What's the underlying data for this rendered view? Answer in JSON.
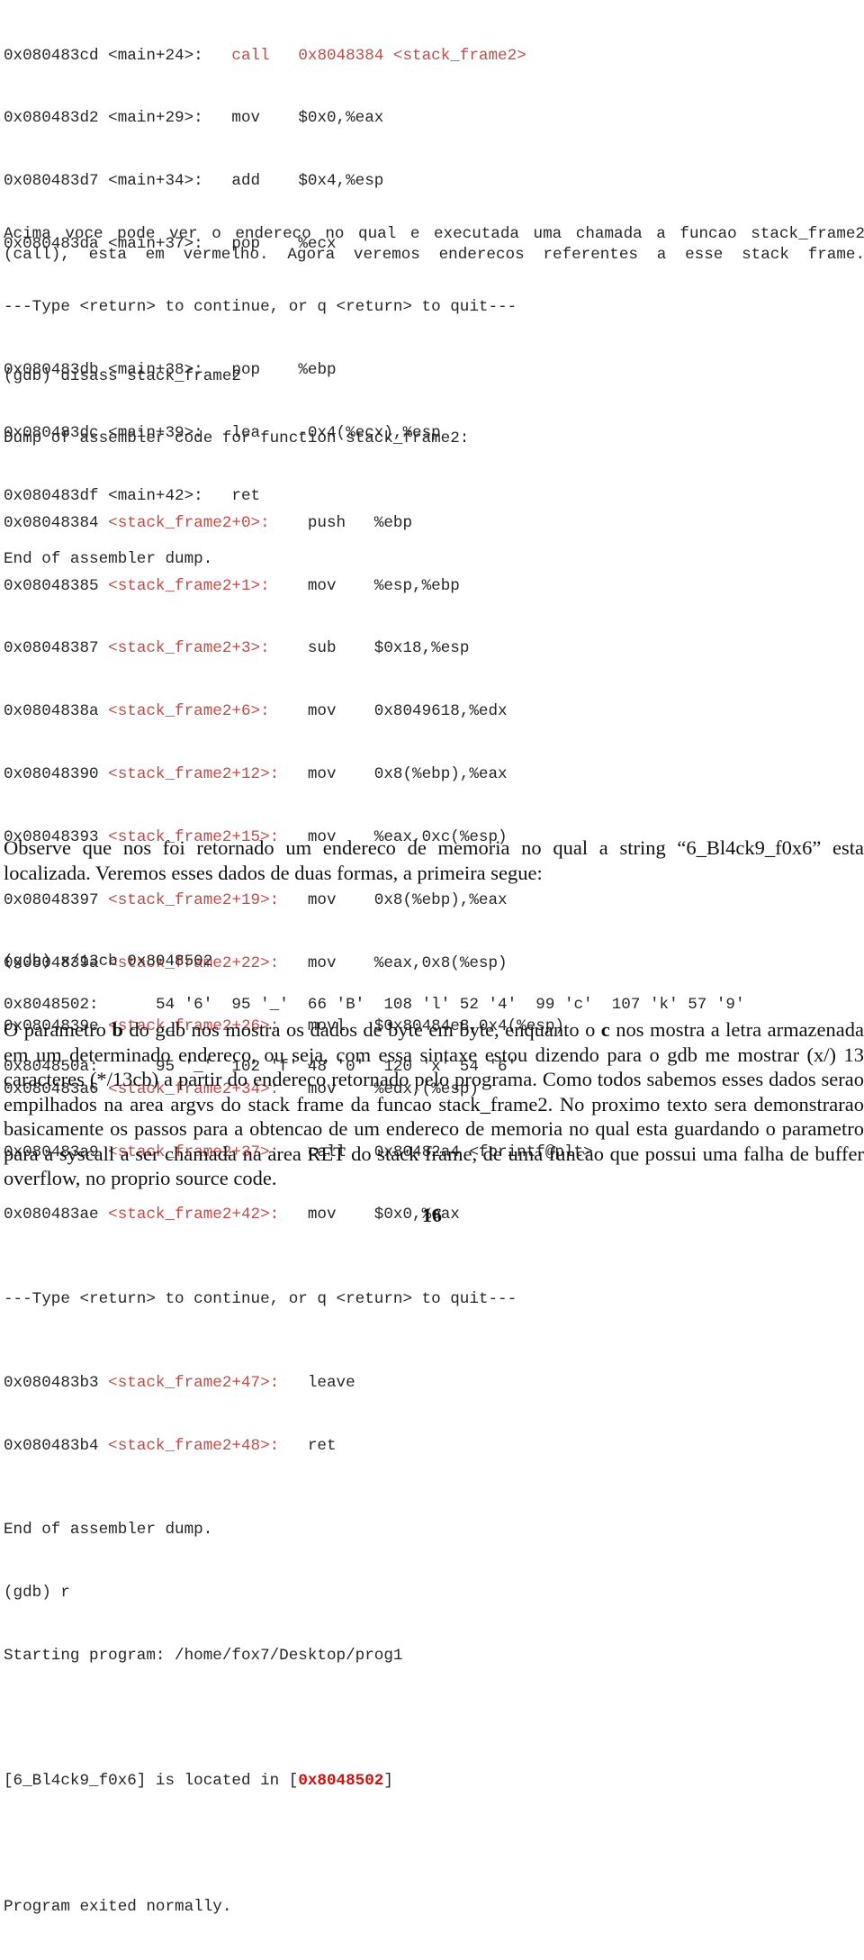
{
  "page": {
    "number": "16",
    "accent_red": "#bf4b47",
    "highlight_red": "#cc1111",
    "text_color": "#262626"
  },
  "disassembly_main": {
    "lines": [
      {
        "addr": "0x080483cd <main+24>:   ",
        "mnemonic": "call",
        "gap": "   ",
        "operand": "0x8048384 <stack_frame2>",
        "red_from": "mnemonic"
      },
      {
        "addr": "0x080483d2 <main+29>:   ",
        "mnemonic": "mov",
        "gap": "    ",
        "operand": "$0x0,%eax",
        "red_from": "none"
      },
      {
        "addr": "0x080483d7 <main+34>:   ",
        "mnemonic": "add",
        "gap": "    ",
        "operand": "$0x4,%esp",
        "red_from": "none"
      },
      {
        "addr": "0x080483da <main+37>:   ",
        "mnemonic": "pop",
        "gap": "    ",
        "operand": "%ecx",
        "red_from": "none"
      }
    ],
    "pager_prompt": "---Type <return> to continue, or q <return> to quit---",
    "lines_after": [
      {
        "addr": "0x080483db <main+38>:   ",
        "mnemonic": "pop",
        "gap": "    ",
        "operand": "%ebp",
        "red_from": "none"
      },
      {
        "addr": "0x080483dc <main+39>:   ",
        "mnemonic": "lea",
        "gap": "    ",
        "operand": "-0x4(%ecx),%esp",
        "red_from": "none"
      },
      {
        "addr": "0x080483df <main+42>:   ",
        "mnemonic": "ret",
        "gap": "",
        "operand": "",
        "red_from": "none"
      }
    ],
    "end_line": "End of assembler dump."
  },
  "paragraph_1": {
    "text": "Acima voce pode ver o endereco no qual e executada uma chamada a funcao stack_frame2 (call), esta em vermelho. Agora veremos enderecos referentes a esse stack frame."
  },
  "disassembly_sf2": {
    "command": "(gdb) disass stack_frame2",
    "header": "Dump of assembler code for function stack_frame2:",
    "rows": [
      {
        "addr": "0x08048384 ",
        "sym": "<stack_frame2+0>: ",
        "pad": "   ",
        "mnemonic": "push",
        "gap": "   ",
        "operand": "%ebp"
      },
      {
        "addr": "0x08048385 ",
        "sym": "<stack_frame2+1>: ",
        "pad": "   ",
        "mnemonic": "mov",
        "gap": "    ",
        "operand": "%esp,%ebp"
      },
      {
        "addr": "0x08048387 ",
        "sym": "<stack_frame2+3>: ",
        "pad": "   ",
        "mnemonic": "sub",
        "gap": "    ",
        "operand": "$0x18,%esp"
      },
      {
        "addr": "0x0804838a ",
        "sym": "<stack_frame2+6>: ",
        "pad": "   ",
        "mnemonic": "mov",
        "gap": "    ",
        "operand": "0x8049618,%edx"
      },
      {
        "addr": "0x08048390 ",
        "sym": "<stack_frame2+12>:",
        "pad": "   ",
        "mnemonic": "mov",
        "gap": "    ",
        "operand": "0x8(%ebp),%eax"
      },
      {
        "addr": "0x08048393 ",
        "sym": "<stack_frame2+15>:",
        "pad": "   ",
        "mnemonic": "mov",
        "gap": "    ",
        "operand": "%eax,0xc(%esp)"
      },
      {
        "addr": "0x08048397 ",
        "sym": "<stack_frame2+19>:",
        "pad": "   ",
        "mnemonic": "mov",
        "gap": "    ",
        "operand": "0x8(%ebp),%eax"
      },
      {
        "addr": "0x0804839a ",
        "sym": "<stack_frame2+22>:",
        "pad": "   ",
        "mnemonic": "mov",
        "gap": "    ",
        "operand": "%eax,0x8(%esp)"
      },
      {
        "addr": "0x0804839e ",
        "sym": "<stack_frame2+26>:",
        "pad": "   ",
        "mnemonic": "movl",
        "gap": "   ",
        "operand": "$0x80484e8,0x4(%esp)"
      },
      {
        "addr": "0x080483a6 ",
        "sym": "<stack_frame2+34>:",
        "pad": "   ",
        "mnemonic": "mov",
        "gap": "    ",
        "operand": "%edx,(%esp)"
      },
      {
        "addr": "0x080483a9 ",
        "sym": "<stack_frame2+37>:",
        "pad": "   ",
        "mnemonic": "call",
        "gap": "   ",
        "operand": "0x80482a4 <fprintf@plt>"
      },
      {
        "addr": "0x080483ae ",
        "sym": "<stack_frame2+42>:",
        "pad": "   ",
        "mnemonic": "mov",
        "gap": "    ",
        "operand": "$0x0,%eax"
      }
    ],
    "pager_prompt": "---Type <return> to continue, or q <return> to quit---",
    "rows_after": [
      {
        "addr": "0x080483b3 ",
        "sym": "<stack_frame2+47>:",
        "pad": "   ",
        "mnemonic": "leave",
        "gap": "",
        "operand": ""
      },
      {
        "addr": "0x080483b4 ",
        "sym": "<stack_frame2+48>:",
        "pad": "   ",
        "mnemonic": "ret",
        "gap": "",
        "operand": ""
      }
    ],
    "end_line": "End of assembler dump."
  },
  "run_session": {
    "command": "(gdb) r",
    "starting": "Starting program: /home/fox7/Desktop/prog1",
    "output_prefix": "[6_Bl4ck9_f0x6] is located in [",
    "output_address": "0x8048502",
    "output_suffix": "]",
    "exit_line": "Program exited normally."
  },
  "paragraph_2": {
    "text": "Observe que nos foi retornado um endereco de memoria no qual a string “6_Bl4ck9_f0x6” esta localizada. Veremos esses dados de duas formas, a primeira segue:"
  },
  "examine_command": {
    "line": "(gdb) x/13cb 0x8048502"
  },
  "hexdump": {
    "rows": [
      {
        "address": "0x8048502:",
        "pad": "      ",
        "cells": "54 '6'  95 '_'  66 'B'  108 'l' 52 '4'  99 'c'  107 'k' 57 '9'"
      },
      {
        "address": "0x804850a:",
        "pad": "      ",
        "cells": "95 '_'  102 'f' 48 '0'  120 'x' 54 '6'"
      }
    ]
  },
  "paragraph_3": {
    "part_1": "O parametro ",
    "bold_1": "b",
    "part_2": " do gdb nos mostra os dados de byte em byte, enquanto o ",
    "bold_2": "c",
    "part_3": " nos mostra a letra armazenada em um determinado endereco, ou seja, com essa sintaxe estou dizendo para o gdb me mostrar (x/) 13 caracteres (*/13cb) a partir do endereco retornado pelo programa. Como todos sabemos esses dados serao empilhados na area argvs do stack frame da funcao stack_frame2. No proximo texto sera demonstrarao basicamente os passos para a obtencao de um endereco de memoria no qual esta guardando o parametro para a syscall a ser chamada na area RET do stack frame, de uma funcao que possui uma falha de buffer overflow, no proprio source code."
  }
}
